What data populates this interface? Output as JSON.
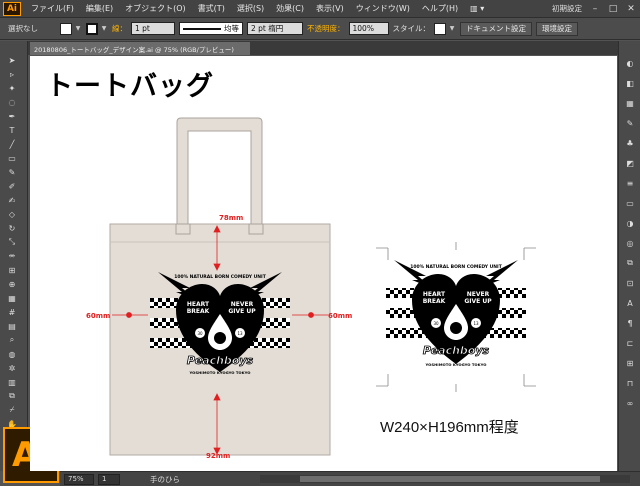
{
  "app": {
    "logo": "Ai",
    "workspace": "初期設定",
    "brand_color": "#ff9a00"
  },
  "menu": [
    "ファイル(F)",
    "編集(E)",
    "オブジェクト(O)",
    "書式(T)",
    "選択(S)",
    "効果(C)",
    "表示(V)",
    "ウィンドウ(W)",
    "ヘルプ(H)"
  ],
  "control": {
    "selection": "選択なし",
    "stroke_label": "線：",
    "stroke_weight": "1 pt",
    "stroke_style": "均等",
    "brush": "2 pt 楕円",
    "opacity_label": "不透明度：",
    "opacity_value": "100%",
    "style_label": "スタイル：",
    "doc_settings": "ドキュメント設定",
    "preferences": "環境設定"
  },
  "tab": {
    "title": "20180806_トートバッグ_デザイン案.ai @ 75% (RGB/プレビュー)"
  },
  "artboard": {
    "title": "トートバッグ",
    "caption": "W240×H196mm程度",
    "dim_top": "78mm",
    "dim_left": "60mm",
    "dim_right": "60mm",
    "dim_bottom": "92mm"
  },
  "logo_art": {
    "arc_text": "100% NATURAL BORN COMEDY UNIT",
    "left_text_1": "HEART",
    "left_text_2": "BREAK",
    "right_text_1": "NEVER",
    "right_text_2": "GIVE UP",
    "num_left": "30",
    "num_right": "13",
    "brand": "Peachboys",
    "bottom_text": "YOSHIMOTO KYOGYO TOKYO"
  },
  "status": {
    "zoom": "75%",
    "page": "1",
    "tool": "手のひら"
  },
  "icons": {
    "tools": [
      "selection-tool-icon",
      "direct-selection-tool-icon",
      "magic-wand-icon",
      "lasso-icon",
      "pen-tool-icon",
      "type-tool-icon",
      "line-tool-icon",
      "rectangle-tool-icon",
      "paintbrush-icon",
      "pencil-icon",
      "blob-brush-icon",
      "eraser-icon",
      "rotate-tool-icon",
      "scale-tool-icon",
      "width-tool-icon",
      "free-transform-icon",
      "shape-builder-icon",
      "perspective-grid-icon",
      "mesh-tool-icon",
      "gradient-tool-icon",
      "eyedropper-icon",
      "blend-tool-icon",
      "symbol-sprayer-icon",
      "graph-tool-icon",
      "artboard-tool-icon",
      "slice-tool-icon",
      "hand-tool-icon",
      "zoom-tool-icon"
    ],
    "panels": [
      "color-panel-icon",
      "color-guide-icon",
      "swatches-icon",
      "brushes-icon",
      "symbols-icon",
      "graphic-styles-icon",
      "stroke-icon",
      "gradient-icon",
      "transparency-icon",
      "appearance-icon",
      "layers-icon",
      "artboards-icon",
      "character-icon",
      "paragraph-icon",
      "align-icon",
      "transform-icon",
      "pathfinder-icon",
      "links-icon"
    ]
  }
}
